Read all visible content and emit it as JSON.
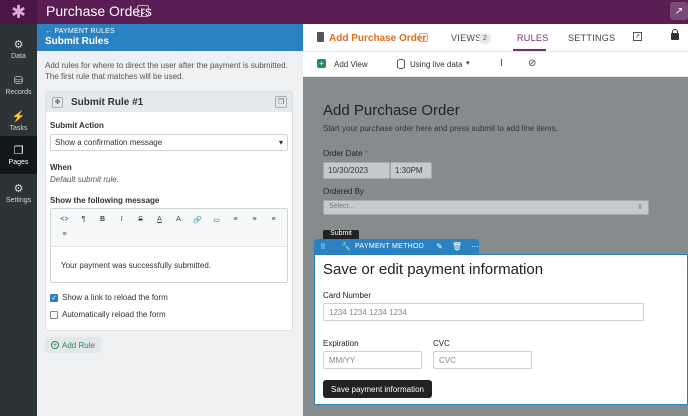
{
  "app": {
    "title": "Purchase Orders",
    "caret": "⌄",
    "ext": "↗",
    "logo": "✱"
  },
  "nav": [
    {
      "label": "Data",
      "icon": "⚙"
    },
    {
      "label": "Records",
      "icon": "⛁"
    },
    {
      "label": "Tasks",
      "icon": "⚡"
    },
    {
      "label": "Pages",
      "icon": "❐"
    },
    {
      "label": "Settings",
      "icon": "⚙"
    }
  ],
  "panel": {
    "crumb": "← PAYMENT RULES",
    "title": "Submit Rules",
    "description": "Add rules for where to direct the user after the payment is submitted. The first rule that matches will be used.",
    "rule_title": "Submit Rule #1",
    "submit_action_label": "Submit Action",
    "submit_action_value": "Show a confirmation message",
    "when_label": "When",
    "when_value": "Default submit rule.",
    "message_label": "Show the following message",
    "toolbar": [
      "<>",
      "¶",
      "B",
      "I",
      "S",
      "A",
      "A",
      "🔗",
      "▭",
      "≡",
      "≡",
      "≡",
      "≡"
    ],
    "message": "Your payment was successfully submitted.",
    "checkbox1": "Show a link to reload the form",
    "checkbox2": "Automatically reload the form",
    "add_rule": "Add Rule"
  },
  "header": {
    "page_name": "Add Purchase Order",
    "tab_views": "VIEWS",
    "views_count": "2",
    "tab_rules": "RULES",
    "tab_settings": "SETTINGS"
  },
  "subbar": {
    "add_view": "Add View",
    "live_data": "Using live data",
    "caret": "▾"
  },
  "view": {
    "title": "Add Purchase Order",
    "subtitle": "Start your purchase order here and press submit to add line items.",
    "order_date_label": "Order Date",
    "required_mark": "*",
    "date_value": "10/30/2023",
    "time_value": "1:30PM",
    "ordered_by_label": "Ordered By",
    "ordered_by_placeholder": "Select...",
    "submit_peek": "Submit"
  },
  "payment": {
    "tab_label": "PAYMENT METHOD",
    "title": "Save or edit payment information",
    "card_label": "Card Number",
    "card_placeholder": "1234 1234 1234 1234",
    "exp_label": "Expiration",
    "exp_placeholder": "MM/YY",
    "cvc_label": "CVC",
    "cvc_placeholder": "CVC",
    "save_button": "Save payment information"
  }
}
